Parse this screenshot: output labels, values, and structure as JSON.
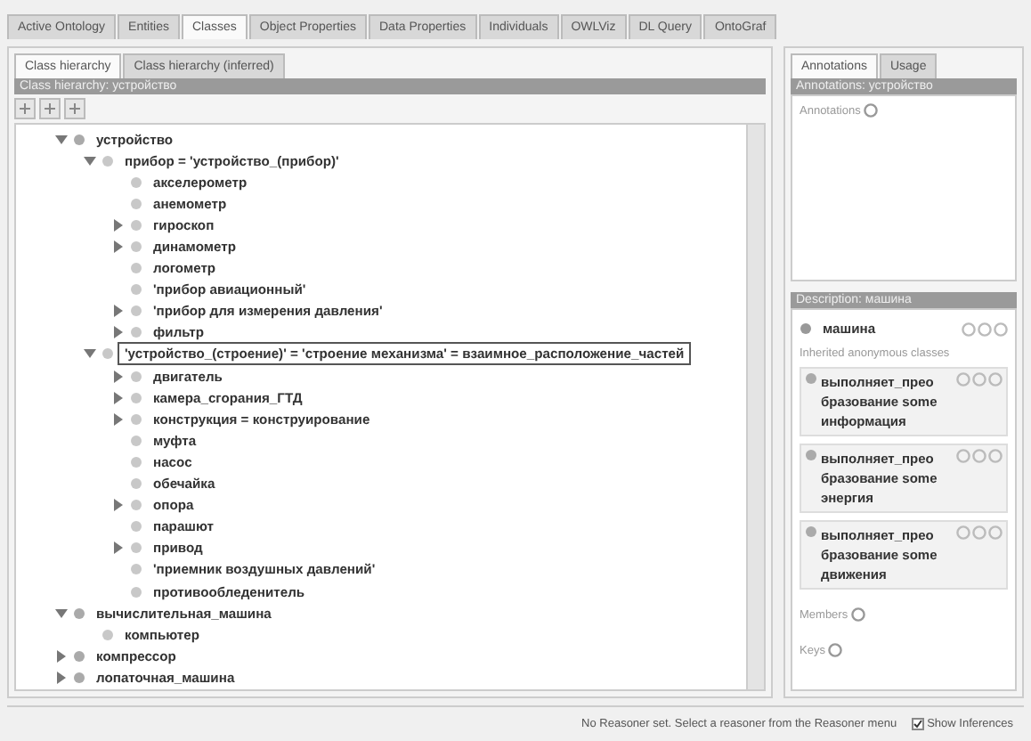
{
  "tabs": [
    {
      "label": "Active Ontology",
      "selected": false
    },
    {
      "label": "Entities",
      "selected": false
    },
    {
      "label": "Classes",
      "selected": true
    },
    {
      "label": "Object Properties",
      "selected": false
    },
    {
      "label": "Data Properties",
      "selected": false
    },
    {
      "label": "Individuals",
      "selected": false
    },
    {
      "label": "OWLViz",
      "selected": false
    },
    {
      "label": "DL Query",
      "selected": false
    },
    {
      "label": "OntoGraf",
      "selected": false
    }
  ],
  "left": {
    "tabs": [
      {
        "label": "Class hierarchy",
        "selected": true
      },
      {
        "label": "Class hierarchy (inferred)",
        "selected": false
      }
    ],
    "header": "Class hierarchy: устройство",
    "tree": [
      {
        "label": "устройство",
        "expanded": true,
        "selected": false,
        "children": [
          {
            "label": "прибор = 'устройство_(прибор)'",
            "expanded": true,
            "selected": false,
            "children": [
              {
                "label": "акселерометр",
                "expanded": false,
                "selected": false
              },
              {
                "label": "анемометр",
                "expanded": false,
                "selected": false
              },
              {
                "label": "гироскоп",
                "expanded": false,
                "expandable": true,
                "selected": false
              },
              {
                "label": "динамометр",
                "expanded": false,
                "expandable": true,
                "selected": false
              },
              {
                "label": "логометр",
                "expanded": false,
                "selected": false
              },
              {
                "label": "'прибор авиационный'",
                "expanded": false,
                "selected": false
              },
              {
                "label": "'прибор для измерения давления'",
                "expanded": false,
                "expandable": true,
                "selected": false
              },
              {
                "label": "фильтр",
                "expanded": false,
                "expandable": true,
                "selected": false
              }
            ]
          },
          {
            "label": "'устройство_(строение)' = 'строение механизма' = взаимное_расположение_частей",
            "expanded": true,
            "selected": true,
            "children": [
              {
                "label": "двигатель",
                "expanded": false,
                "expandable": true,
                "selected": false
              },
              {
                "label": "камера_сгорания_ГТД",
                "expanded": false,
                "expandable": true,
                "selected": false
              },
              {
                "label": "конструкция = конструирование",
                "expanded": false,
                "expandable": true,
                "selected": false
              },
              {
                "label": "муфта",
                "expanded": false,
                "selected": false
              },
              {
                "label": "насос",
                "expanded": false,
                "selected": false
              },
              {
                "label": "обечайка",
                "expanded": false,
                "selected": false
              },
              {
                "label": "опора",
                "expanded": false,
                "expandable": true,
                "selected": false
              },
              {
                "label": "парашют",
                "expanded": false,
                "selected": false
              },
              {
                "label": "привод",
                "expanded": false,
                "expandable": true,
                "selected": false
              },
              {
                "label": "'приемник воздушных давлений'",
                "expanded": false,
                "selected": false
              },
              {
                "label": "противообледенитель",
                "expanded": false,
                "selected": false
              }
            ]
          }
        ]
      },
      {
        "label": "вычислительная_машина",
        "expanded": true,
        "selected": false,
        "children": [
          {
            "label": "компьютер",
            "expanded": false,
            "selected": false
          }
        ]
      },
      {
        "label": "компрессор",
        "expanded": false,
        "expandable": true,
        "selected": false
      },
      {
        "label": "лопаточная_машина",
        "expanded": false,
        "expandable": true,
        "selected": false
      }
    ]
  },
  "right": {
    "tabs": [
      {
        "label": "Annotations",
        "selected": true
      },
      {
        "label": "Usage",
        "selected": false
      }
    ],
    "header": "Annotations: устройство",
    "annotations_label": "Annotations",
    "description_header": "Description: машина",
    "class_name": "машина",
    "section": "Inherited anonymous classes",
    "items": [
      "выполняет_преобразование some информация",
      "выполняет_преобразование some энергия",
      "выполняет_преобразование some движения"
    ],
    "members_label": "Members",
    "keys_label": "Keys"
  },
  "status": {
    "text": "No Reasoner set. Select a reasoner from the Reasoner menu",
    "show_inferences": {
      "label": "Show Inferences",
      "checked": true
    }
  }
}
